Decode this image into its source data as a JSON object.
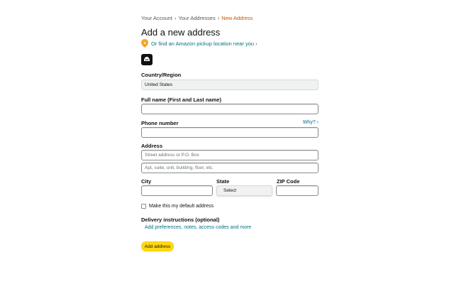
{
  "breadcrumb": {
    "items": [
      "Your Account",
      "Your Addresses"
    ],
    "separator": "›",
    "current": "New Address"
  },
  "title": "Add a new address",
  "pickup": {
    "icon": "location-pin-icon",
    "text": "Or find an Amazon pickup location near you ›"
  },
  "logo": {
    "icon": "brand-logo-icon"
  },
  "form": {
    "country": {
      "label": "Country/Region",
      "value": "United States"
    },
    "full_name": {
      "label": "Full name (First and Last name)",
      "value": ""
    },
    "phone": {
      "label": "Phone number",
      "value": "",
      "why": "Why? ›"
    },
    "address": {
      "label": "Address",
      "line1_placeholder": "Street address or P.O. Box",
      "line2_placeholder": "Apt, suite, unit, building, floor, etc."
    },
    "city": {
      "label": "City",
      "value": ""
    },
    "state": {
      "label": "State",
      "value": "Select"
    },
    "zip": {
      "label": "ZIP Code",
      "value": ""
    },
    "default_checkbox": {
      "label": "Make this my default address",
      "checked": false
    },
    "delivery": {
      "label": "Delivery instructions (optional)",
      "link": "Add preferences, notes, access codes and more"
    },
    "submit_label": "Add address"
  },
  "colors": {
    "link": "#007185",
    "accent": "#c45500",
    "button": "#ffd814",
    "pin": "#f5a623"
  }
}
